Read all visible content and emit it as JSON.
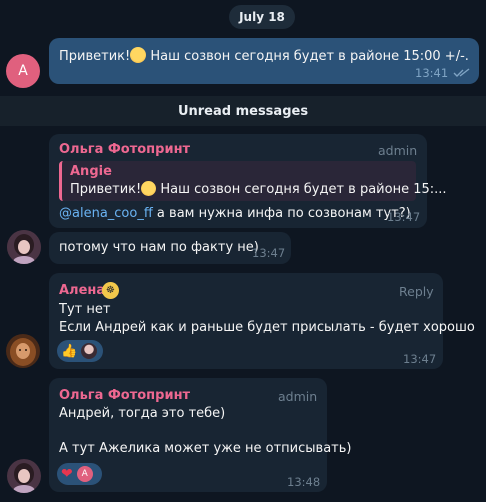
{
  "date_divider": "July 18",
  "unread_label": "Unread messages",
  "colors": {
    "background": "#0e1621",
    "bubble_in": "#182533",
    "bubble_out": "#2b5278",
    "sender": "#ee6891",
    "link": "#6ab3f3"
  },
  "messages": [
    {
      "avatar_letter": "A",
      "text_before": "Приветик!",
      "emoji": "sun-emoji",
      "text_after": " Наш созвон сегодня будет в районе 15:00 +/-.",
      "time": "13:41",
      "status_icon": "double-check-icon"
    },
    {
      "sender": "Ольга Фотопринт",
      "role": "admin",
      "quote": {
        "name": "Angie",
        "text_before": "Приветик!",
        "text_after": " Наш созвон сегодня будет в районе 15:..."
      },
      "mention": "@alena_coo_ff",
      "text": " а вам нужна инфа по созвонам тут?)",
      "time": "13:47"
    },
    {
      "text": "потому что нам по факту не)",
      "time": "13:47"
    },
    {
      "sender": "Алена",
      "action": "Reply",
      "lines": [
        "Тут нет",
        "Если Андрей как и раньше будет присылать - будет хорошо"
      ],
      "reaction": "thumbs-up",
      "time": "13:47"
    },
    {
      "sender": "Ольга Фотопринт",
      "role": "admin",
      "lines": [
        "Андрей, тогда это тебе)",
        "",
        "А тут Ажелика может уже не отписывать)"
      ],
      "reaction": "heart",
      "reaction_avatar_letter": "A",
      "time": "13:48"
    }
  ]
}
